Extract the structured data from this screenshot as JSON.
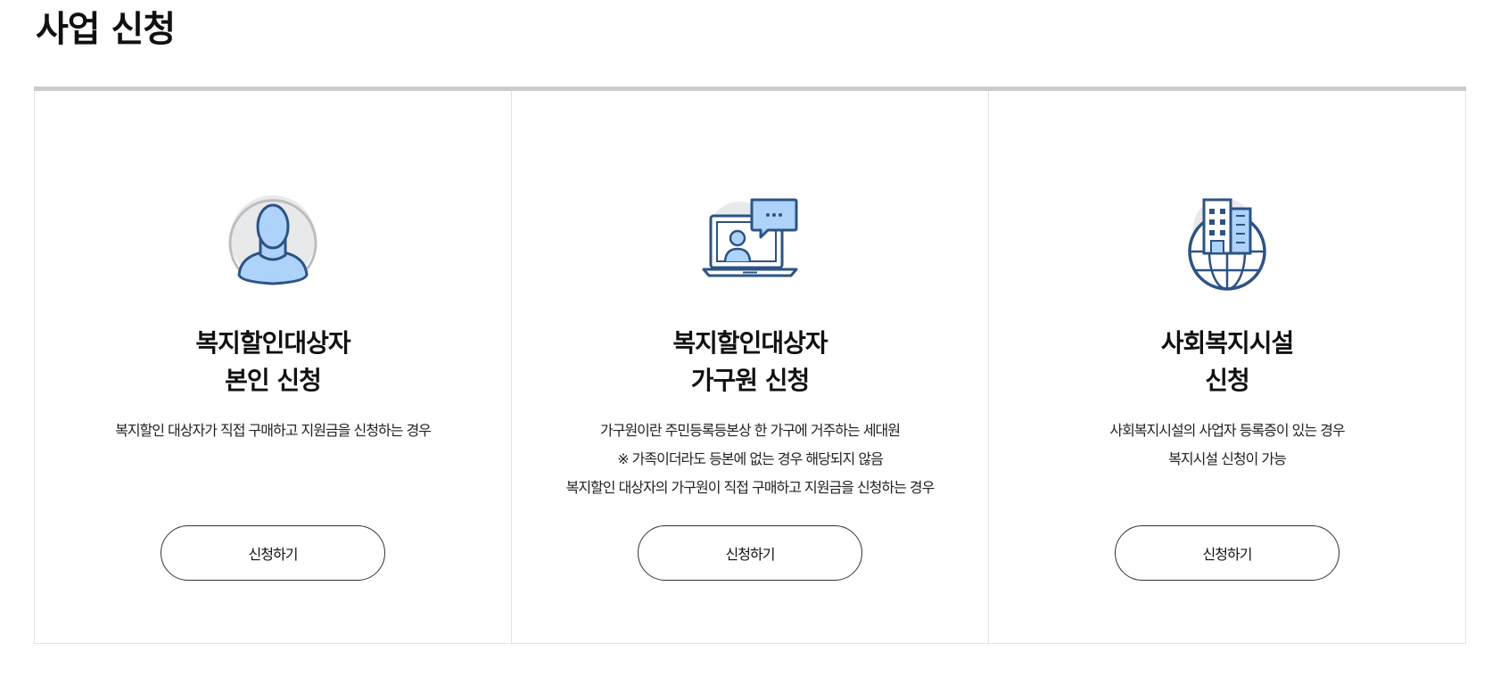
{
  "page": {
    "title": "사업 신청"
  },
  "cards": [
    {
      "icon": "person-icon",
      "title_line1": "복지할인대상자",
      "title_line2": "본인 신청",
      "desc": [
        "복지할인 대상자가 직접 구매하고 지원금을 신청하는 경우"
      ],
      "button_label": "신청하기"
    },
    {
      "icon": "laptop-chat-icon",
      "title_line1": "복지할인대상자",
      "title_line2": "가구원 신청",
      "desc": [
        "가구원이란 주민등록등본상 한 가구에 거주하는 세대원",
        "※ 가족이더라도 등본에 없는 경우 해당되지 않음",
        "복지할인 대상자의 가구원이 직접 구매하고 지원금을 신청하는 경우"
      ],
      "button_label": "신청하기"
    },
    {
      "icon": "building-globe-icon",
      "title_line1": "사회복지시설",
      "title_line2": "신청",
      "desc": [
        "사회복지시설의 사업자 등록증이 있는 경우",
        "복지시설 신청이 가능"
      ],
      "button_label": "신청하기"
    }
  ],
  "colors": {
    "icon_stroke": "#2d5384",
    "icon_fill": "#aed3fb",
    "icon_bg": "#e5e7ea",
    "divider": "#cccccc"
  }
}
